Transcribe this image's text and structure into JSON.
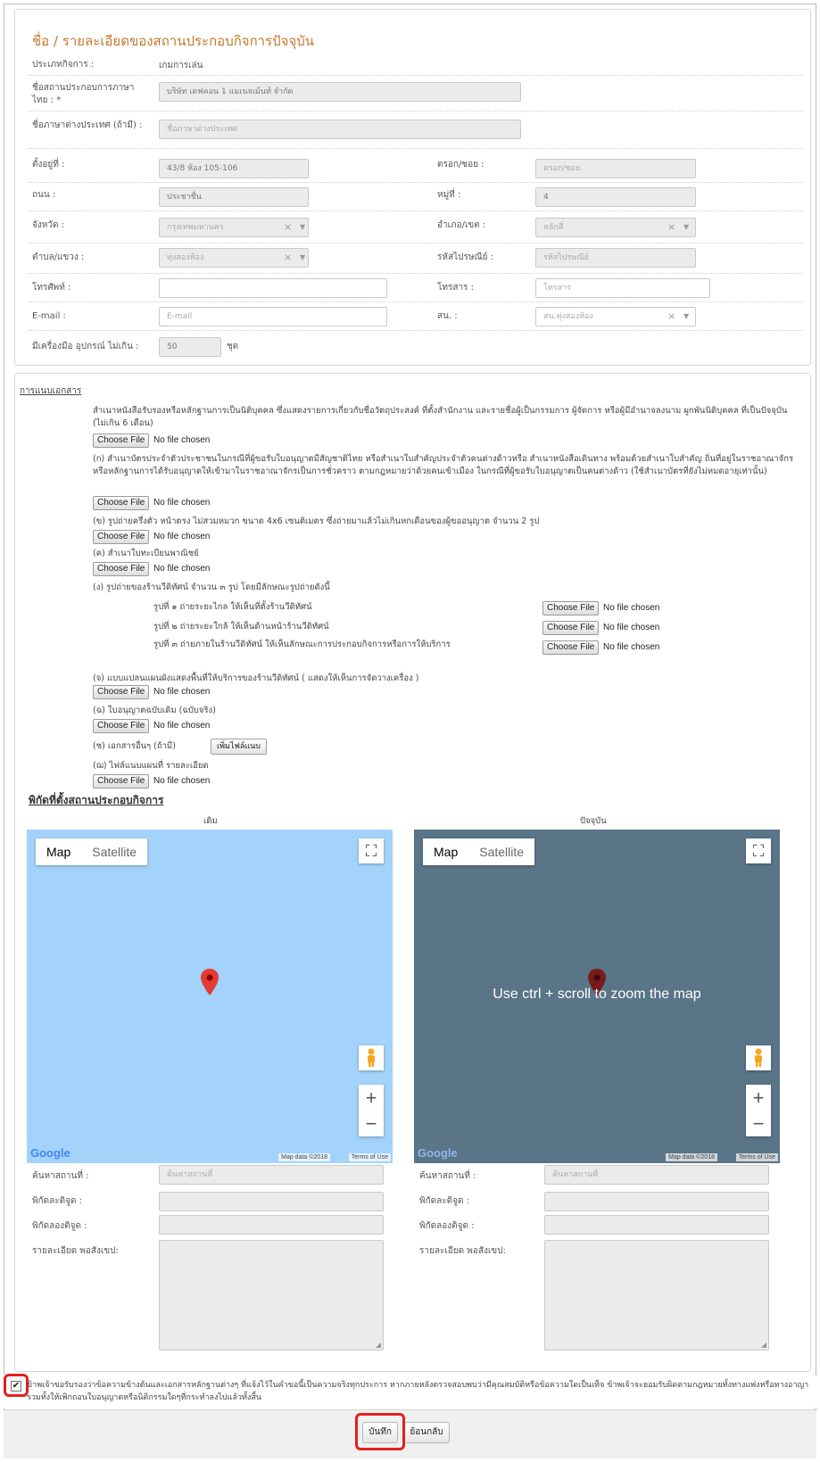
{
  "section": {
    "title": "ชื่อ / รายละเอียดของสถานประกอบกิจการปัจจุบัน"
  },
  "business_info": {
    "type_label": "ประเภทกิจการ :",
    "type_value": "เกมการเล่น",
    "name_th_label": "ชื่อสถานประกอบการภาษาไทย : *",
    "name_th_value": "บริษัท เดฟคอน 1 แมเนจเม้นท์ จำกัด",
    "name_foreign_label": "ชื่อภาษาต่างประเทศ (ถ้ามี) :",
    "name_foreign_placeholder": "ชื่อภาษาต่างประเทศ"
  },
  "address": {
    "address_label": "ตั้งอยู่ที่ :",
    "address_value": "43/8 ห้อง 105-106",
    "alley_label": "ตรอก/ซอย :",
    "alley_placeholder": "ตรอก/ซอย",
    "road_label": "ถนน :",
    "road_value": "ประชาชื่น",
    "moo_label": "หมู่ที่ :",
    "moo_value": "4",
    "province_label": "จังหวัด :",
    "province_value": "กรุงเทพมหานคร",
    "district_label": "อำเภอ/เขต :",
    "district_value": "หลักสี่",
    "subdistrict_label": "ตำบล/แขวง :",
    "subdistrict_value": "ทุ่งสองห้อง",
    "postcode_label": "รหัสไปรษณีย์ :",
    "postcode_placeholder": "รหัสไปรษณีย์",
    "phone_label": "โทรศัพท์ :",
    "phone_value": "",
    "fax_label": "โทรสาร :",
    "fax_placeholder": "โทรสาร",
    "email_label": "E-mail :",
    "email_placeholder": "E-mail",
    "police_label": "สน. :",
    "police_value": "สน.ทุ่งสองห้อง",
    "equipment_label": "มีเครื่องมือ อุปกรณ์ ไม่เกิน :",
    "equipment_value": "50",
    "equipment_unit": "ชุด"
  },
  "attachments": {
    "heading": "การแนบเอกสาร",
    "choose_file": "Choose File",
    "no_file": "No file chosen",
    "doc1": "สำเนาหนังสือรับรองหรือหลักฐานการเป็นนิติบุคคล ซึ่งแสดงรายการเกี่ยวกับชื่อวัตถุประสงค์ ที่ตั้งสำนักงาน และรายชื่อผู้เป็นกรรมการ ผู้จัดการ หรือผู้มีอำนาจลงนาม ผูกพันนิติบุคคล ที่เป็นปัจจุบัน (ไม่เกิน 6 เดือน)",
    "doc_k": "(ก) สำเนาบัตรประจำตัวประชาชนในกรณีที่ผู้ขอรับใบอนุญาตมีสัญชาติไทย หรือสำเนาใบสำคัญประจำตัวคนต่างด้าวหรือ สำเนาหนังสือเดินทาง พร้อมด้วยสำเนาใบสำคัญ ถิ่นที่อยู่ในราชอาณาจักรหรือหลักฐานการได้รับอนุญาตให้เข้ามาในราชอาณาจักรเป็นการชั่วคราว ตามกฎหมายว่าด้วยคนเข้าเมือง ในกรณีที่ผู้ขอรับใบอนุญาตเป็นคนต่างด้าว (ใช้สำเนาบัตรที่ยังไม่หมดอายุเท่านั้น)",
    "doc_kh": "(ข) รูปถ่ายครึ่งตัว หน้าตรง ไม่สวมหมวก ขนาด 4x6 เซนติเมตร ซึ่งถ่ายมาแล้วไม่เกินหกเดือนของผู้ขออนุญาต จำนวน 2 รูป",
    "doc_kho": "(ค) สำเนาใบทะเบียนพาณิชย์",
    "doc_ng": "(ง) รูปถ่ายของร้านวีดิทัศน์ จำนวน ๓ รูป โดยมีลักษณะรูปถ่ายดังนี้",
    "photo1": "รูปที่ ๑ ถ่ายระยะไกล ให้เห็นที่ตั้งร้านวีดิทัศน์",
    "photo2": "รูปที่ ๒ ถ่ายระยะใกล้ ให้เห็นด้านหน้าร้านวีดิทัศน์",
    "photo3": "รูปที่ ๓ ถ่ายภายในร้านวีดิทัศน์ ให้เห็นลักษณะการประกอบกิจการหรือการให้บริการ",
    "doc_ch": "(จ) แบบแปลนแผนผังแสดงพื้นที่ให้บริการของร้านวีดิทัศน์ ( แสดงให้เห็นการจัดวางเครื่อง )",
    "doc_chh": "(ฉ) ใบอนุญาตฉบับเดิม (ฉบับจริง)",
    "doc_chor": "(ช) เอกสารอื่นๆ (ถ้ามี)",
    "add_file": "เพิ่มไฟล์แนบ",
    "doc_chhor": "(ฌ) ไฟล์แนบแผนที่ รายละเอียด"
  },
  "location": {
    "heading": "พิกัดที่ตั้งสถานประกอบกิจการ",
    "old_label": "เดิม",
    "current_label": "ปัจจุบัน",
    "map_tab": "Map",
    "satellite_tab": "Satellite",
    "zoom_hint": "Use ctrl + scroll to zoom the map",
    "zoom_in": "+",
    "zoom_out": "−",
    "google": "Google",
    "map_data": "Map data ©2018",
    "terms": "Terms of Use",
    "search_label": "ค้นหาสถานที่ :",
    "search_placeholder": "ค้นหาสถานที่",
    "lat_label": "พิกัดละติจูด :",
    "lng_label": "พิกัดลองติจูด :",
    "detail_label": "รายละเอียด พอสังเขป:"
  },
  "colors": {
    "map_old": "#a3d3fa",
    "map_current": "#5a7488",
    "marker": "#e53935",
    "accent": "#c57a2e"
  },
  "consent": {
    "text": "ข้าพเจ้าขอรับรองว่าข้อความข้างต้นและเอกสารหลักฐานต่างๆ ที่แจ้งไว้ในคำขอนี้เป็นความจริงทุกประการ หากภายหลังตรวจสอบพบว่ามีคุณสมบัติหรือข้อความใดเป็นเท็จ ข้าพเจ้าจะยอมรับผิดตามกฎหมายทั้งทางแพ่งหรือทางอาญา รวมทั้งให้เพิกถอนใบอนุญาตหรือนิติกรรมใดๆที่กระทำลงไปแล้วทั้งสิ้น"
  },
  "actions": {
    "save": "บันทึก",
    "back": "ย้อนกลับ"
  }
}
